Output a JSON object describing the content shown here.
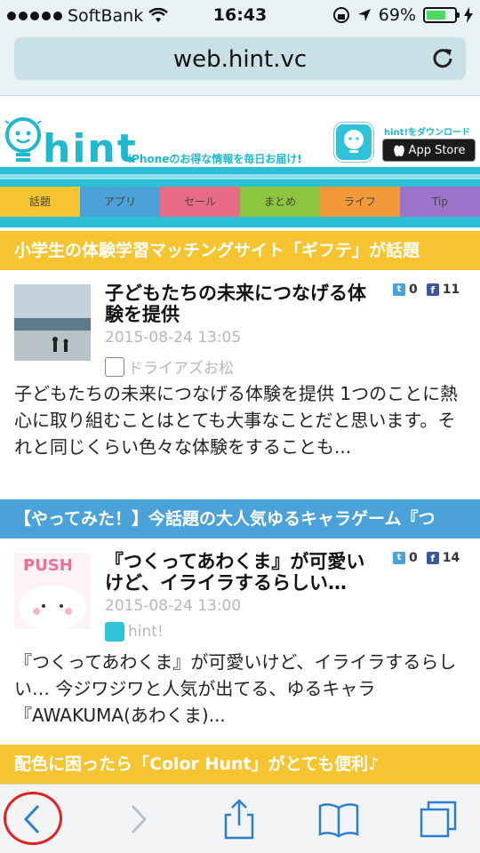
{
  "status_bar": {
    "carrier": "SoftBank",
    "time": "16:43",
    "battery": "69%",
    "battery_level": 0.69
  },
  "browser": {
    "url": "web.hint.vc"
  },
  "site": {
    "logo_text": "hint",
    "tagline": "iPhoneのお得な情報を毎日お届け!",
    "download_label": "hint!をダウンロード",
    "app_store_label": "App Store"
  },
  "tabs": [
    {
      "label": "話題",
      "color": "#f7c431"
    },
    {
      "label": "アプリ",
      "color": "#4aa2d8"
    },
    {
      "label": "セール",
      "color": "#e96b86"
    },
    {
      "label": "まとめ",
      "color": "#8cc63f"
    },
    {
      "label": "ライフ",
      "color": "#f29a38"
    },
    {
      "label": "Tip",
      "color": "#9b73c9"
    }
  ],
  "banners": [
    {
      "text": "小学生の体験学習マッチングサイト「ギフテ」が話題"
    },
    {
      "text": "【やってみた！】今話題の大人気ゆるキャラゲーム『つ"
    },
    {
      "text": "配色に困ったら「Color Hunt」がとても便利♪"
    }
  ],
  "articles": [
    {
      "title": "子どもたちの未来につなげる体験を提供",
      "date": "2015-08-24 13:05",
      "author": "ドライアズお松",
      "tweets": "0",
      "likes": "11",
      "body": "子どもたちの未来につなげる体験を提供 1つのことに熱心に取り組むことはとても大事なことだと思います。それと同じくらい色々な体験をすることも..."
    },
    {
      "title": "『つくってあわくま』が可愛いけど、イライラするらしい…",
      "date": "2015-08-24 13:00",
      "author": "hint!",
      "thumb_label": "PUSH",
      "tweets": "0",
      "likes": "14",
      "body": "『つくってあわくま』が可愛いけど、イライラするらしい… 今ジワジワと人気が出てる、ゆるキャラ『AWAKUMA(あわくま)..."
    }
  ],
  "colors": {
    "brand": "#1fb8cf",
    "banner_yellow": "#f7c431",
    "banner_blue": "#4aa2d8",
    "highlight_circle": "#e32020"
  }
}
